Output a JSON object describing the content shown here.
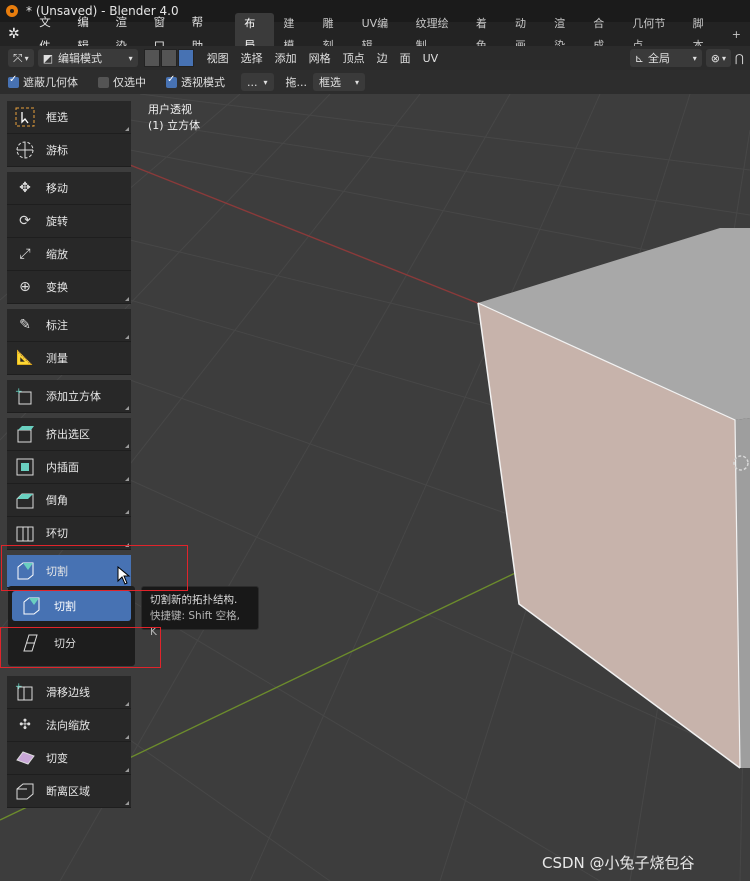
{
  "titlebar": {
    "title": "* (Unsaved) - Blender 4.0"
  },
  "menu": [
    "文件",
    "编辑",
    "渲染",
    "窗口",
    "帮助"
  ],
  "workspaces": [
    "布局",
    "建模",
    "雕刻",
    "UV编辑",
    "纹理绘制",
    "着色",
    "动画",
    "渲染",
    "合成",
    "几何节点",
    "脚本",
    "+"
  ],
  "active_workspace": "布局",
  "header": {
    "mode": "编辑模式",
    "menus": [
      "视图",
      "选择",
      "添加",
      "网格",
      "顶点",
      "边",
      "面",
      "UV"
    ],
    "orientation": "全局"
  },
  "options_bar": {
    "opt1": "遮蔽几何体",
    "opt2": "仅选中",
    "opt3": "透视模式",
    "dots": "...",
    "drag": "拖...",
    "select_mode": "框选"
  },
  "viewport": {
    "view_name": "用户透视",
    "object": "(1) 立方体"
  },
  "tools": [
    {
      "label": "框选",
      "icon": "select-box-icon"
    },
    {
      "label": "游标",
      "icon": "cursor-icon"
    },
    {
      "label": "移动",
      "icon": "move-icon"
    },
    {
      "label": "旋转",
      "icon": "rotate-icon"
    },
    {
      "label": "缩放",
      "icon": "scale-icon"
    },
    {
      "label": "变换",
      "icon": "transform-icon"
    },
    {
      "label": "标注",
      "icon": "annotate-icon"
    },
    {
      "label": "测量",
      "icon": "measure-icon"
    },
    {
      "label": "添加立方体",
      "icon": "add-cube-icon"
    },
    {
      "label": "挤出选区",
      "icon": "extrude-icon"
    },
    {
      "label": "内插面",
      "icon": "inset-icon"
    },
    {
      "label": "倒角",
      "icon": "bevel-icon"
    },
    {
      "label": "环切",
      "icon": "loop-cut-icon"
    },
    {
      "label": "切割",
      "icon": "knife-icon"
    },
    {
      "label": "滑移边线",
      "icon": "edge-slide-icon"
    },
    {
      "label": "法向缩放",
      "icon": "shrink-fatten-icon"
    },
    {
      "label": "切变",
      "icon": "shear-icon"
    },
    {
      "label": "断离区域",
      "icon": "rip-region-icon"
    }
  ],
  "flyout": {
    "item1": "切割",
    "item2": "切分"
  },
  "tooltip": {
    "line1": "切割新的拓扑结构.",
    "line2": "快捷键: Shift 空格, K"
  },
  "watermark": "CSDN @小兔子烧包谷",
  "colors": {
    "accent": "#4772b3",
    "highlight_box": "#e0242b",
    "cube_face": "#c7b3ab"
  }
}
